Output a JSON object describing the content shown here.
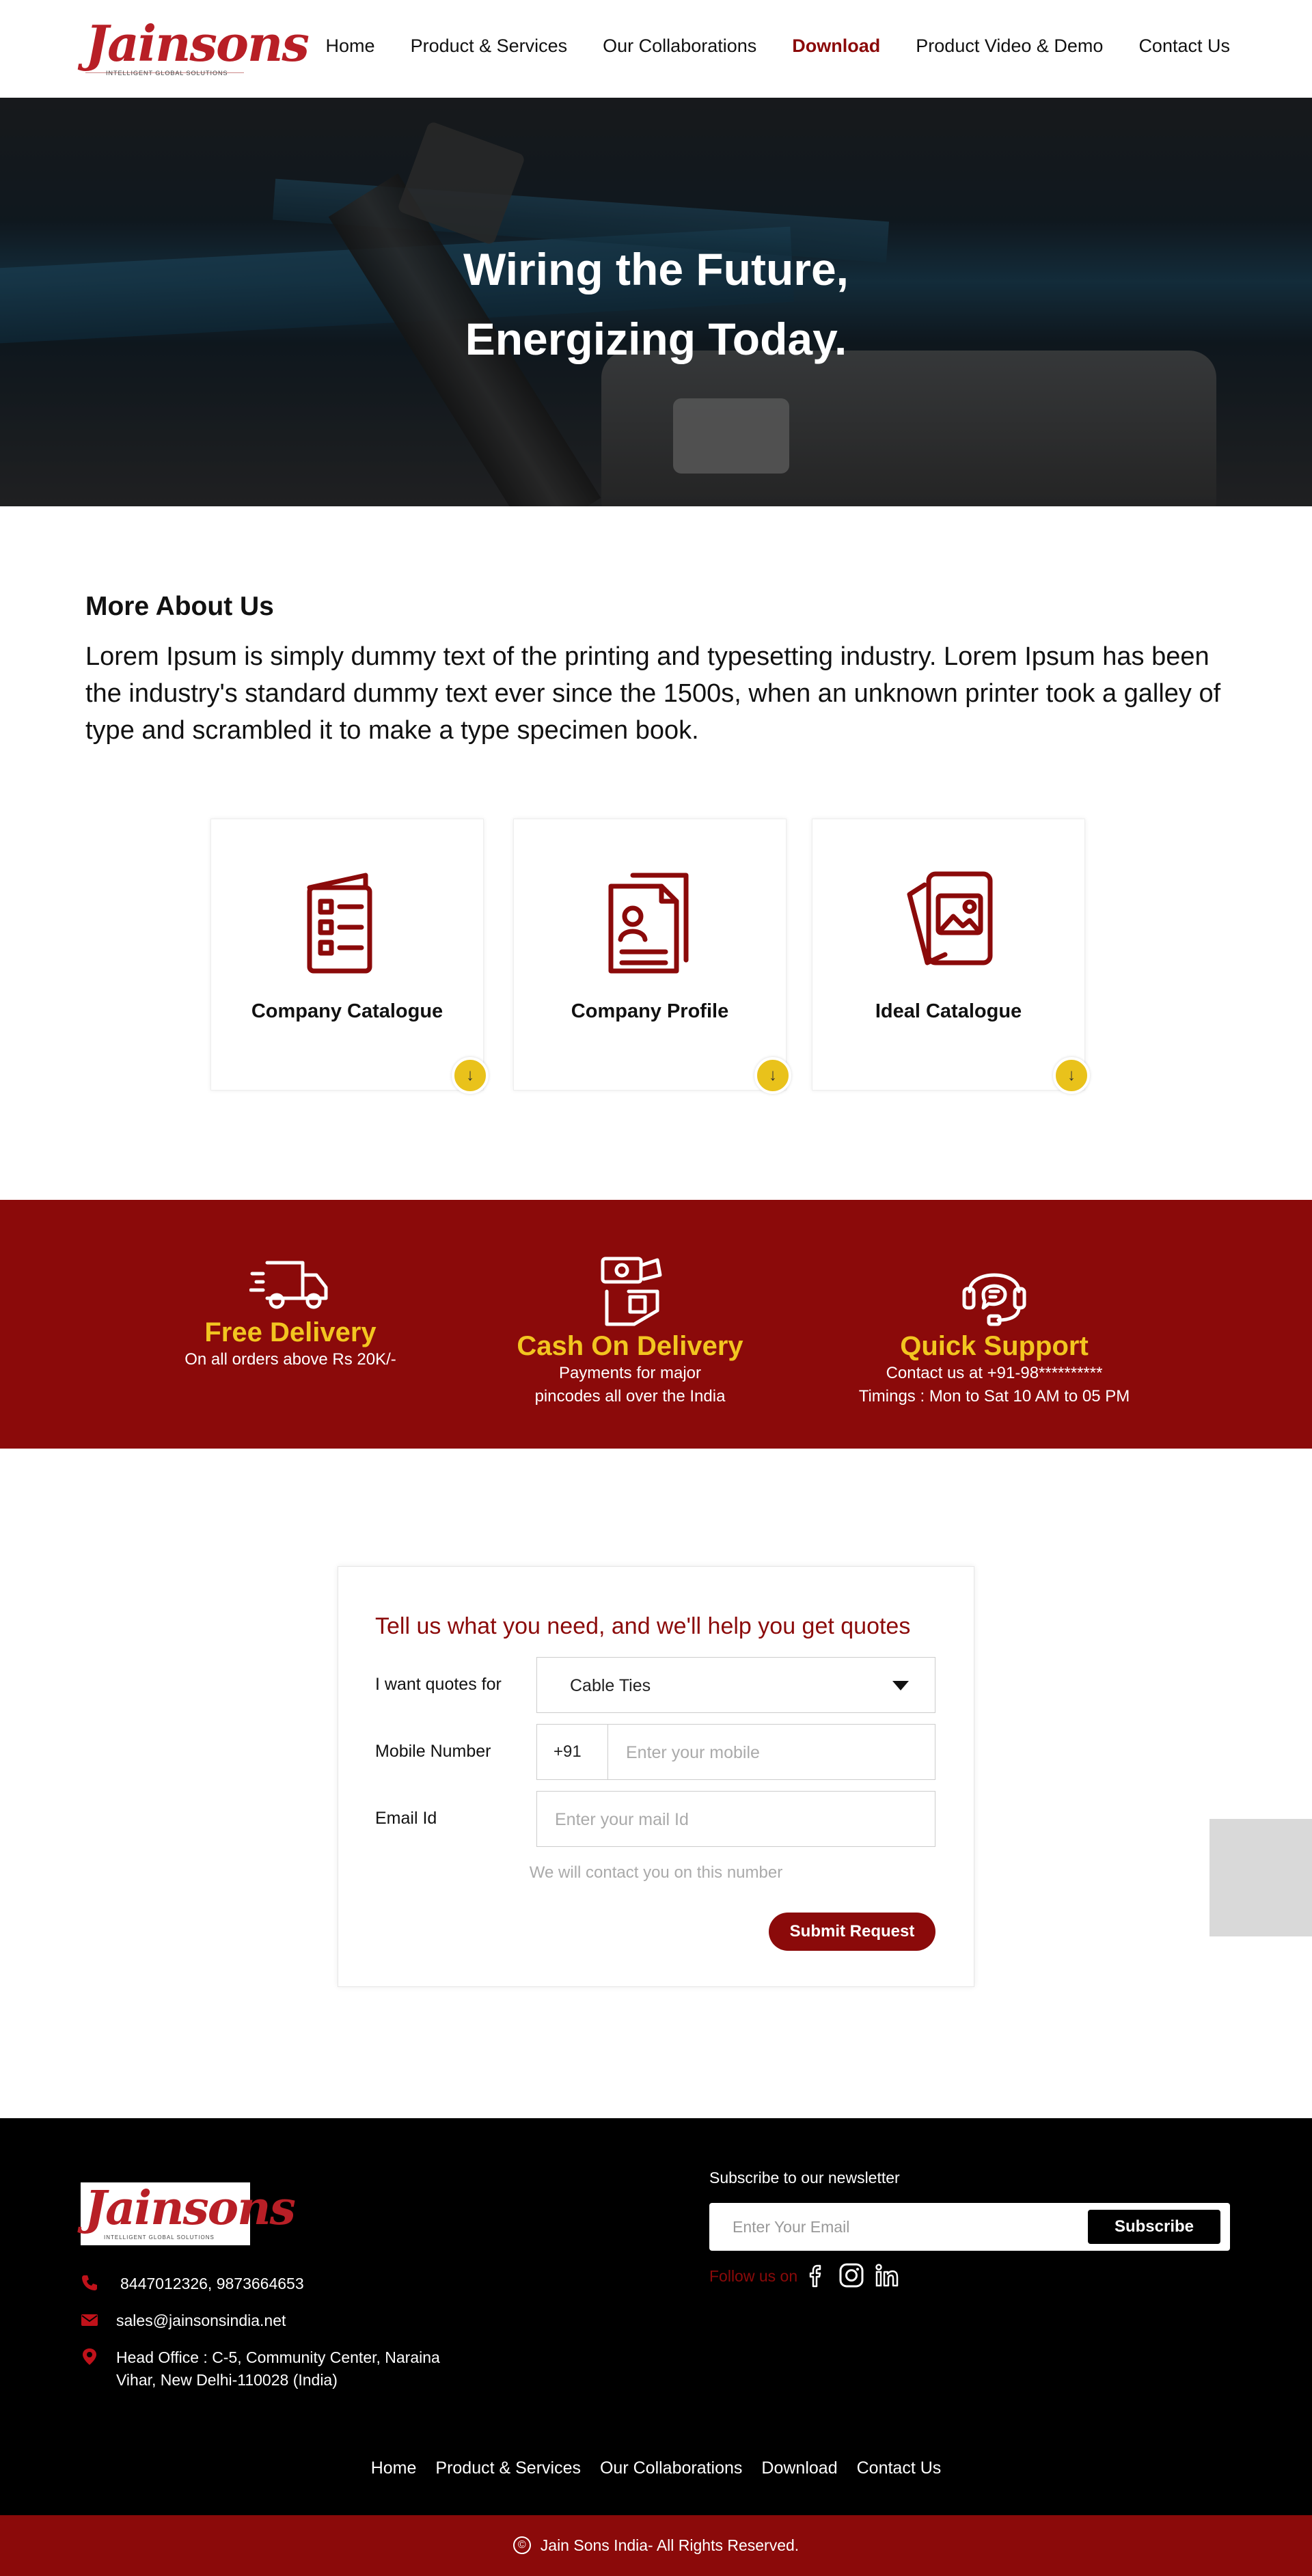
{
  "header": {
    "logo_text": "Jainsons",
    "logo_tagline": "INTELLIGENT GLOBAL SOLUTIONS",
    "nav": [
      "Home",
      "Product & Services",
      "Our Collaborations",
      "Download",
      "Product Video & Demo",
      "Contact Us"
    ],
    "active_nav": "Download"
  },
  "hero": {
    "title_line1": "Wiring the Future,",
    "title_line2": "Energizing Today."
  },
  "about": {
    "heading": "More About Us",
    "text": "Lorem Ipsum is simply dummy text of the printing and typesetting industry. Lorem Ipsum has been the industry's standard dummy text ever since the 1500s, when an unknown printer took a galley of type and scrambled it to make a type specimen book."
  },
  "downloads": [
    {
      "title": "Company Catalogue",
      "icon": "catalogue-icon"
    },
    {
      "title": "Company Profile",
      "icon": "profile-document-icon"
    },
    {
      "title": "Ideal Catalogue",
      "icon": "image-cards-icon"
    }
  ],
  "download_glyph": "↓",
  "features": [
    {
      "title": "Free Delivery",
      "line1": "On all orders above Rs 20K/-",
      "line2": "",
      "icon": "delivery-truck-icon"
    },
    {
      "title": "Cash On Delivery",
      "line1": "Payments for major",
      "line2": "pincodes all over the India",
      "icon": "cash-hand-icon"
    },
    {
      "title": "Quick Support",
      "line1": "Contact us at +91-98**********",
      "line2": "Timings : Mon to Sat 10 AM to 05 PM",
      "icon": "headset-support-icon"
    }
  ],
  "quote_form": {
    "heading": "Tell us what you need, and we'll help you get quotes",
    "quotes_label": "I want quotes for",
    "quotes_value": "Cable Ties",
    "mobile_label": "Mobile Number",
    "country_code": "+91",
    "mobile_placeholder": "Enter your mobile",
    "email_label": "Email Id",
    "email_placeholder": "Enter your mail Id",
    "hint": "We will contact you on this number",
    "submit_label": "Submit Request"
  },
  "footer": {
    "logo_text": "Jainsons",
    "logo_tagline": "INTELLIGENT GLOBAL SOLUTIONS",
    "phone": "8447012326, 9873664653",
    "email": "sales@jainsonsindia.net",
    "address_line1": "Head Office : C-5, Community Center, Naraina",
    "address_line2": "Vihar, New Delhi-110028 (India)",
    "newsletter_label": "Subscribe to our newsletter",
    "newsletter_placeholder": "Enter Your Email",
    "subscribe_label": "Subscribe",
    "follow_label": "Follow us on",
    "links": [
      "Home",
      "Product & Services",
      "Our Collaborations",
      "Download",
      "Contact Us"
    ],
    "copyright_symbol": "©",
    "copyright": "Jain Sons India-  All Rights Reserved."
  },
  "colors": {
    "brand_red": "#8b0a0a",
    "accent_yellow": "#f2c520",
    "download_badge": "#e9c21b"
  }
}
